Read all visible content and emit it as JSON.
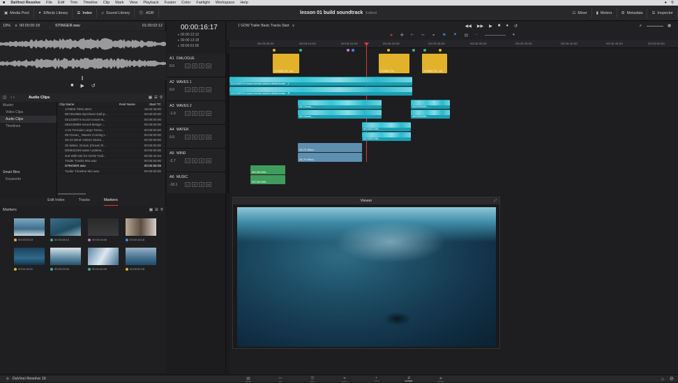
{
  "menubar": {
    "app": "DaVinci Resolve",
    "items": [
      "File",
      "Edit",
      "Trim",
      "Timeline",
      "Clip",
      "Mark",
      "View",
      "Playback",
      "Fusion",
      "Color",
      "Fairlight",
      "Workspace",
      "Help"
    ]
  },
  "toolbar": {
    "media_pool": "Media Pool",
    "effects_library": "Effects Library",
    "index": "Index",
    "sound_library": "Sound Library",
    "adr": "ADR",
    "project_title": "lesson 01 build soundtrack",
    "project_status": "Edited",
    "mixer": "Mixer",
    "meters": "Meters",
    "metadata": "Metadata",
    "inspector": "Inspector"
  },
  "source": {
    "zoom": "19%",
    "timecode_left": "00:00:00:18",
    "clip_name": "STINGER.wav",
    "timecode_right": "01:00:02:12"
  },
  "timeline_header": {
    "timecode": "00:00:16:17",
    "timeline_name": "1 GOW Trailer Basic Tracks Start",
    "tc_rows": [
      "00:00:12:12",
      "00:00:13:18",
      "00:00:01:06"
    ],
    "ruler": [
      "00:00:05:00",
      "00:00:10:00",
      "00:00:15:00",
      "00:00:20:00",
      "00:00:25:00",
      "00:00:30:00",
      "00:00:35:00",
      "00:00:40:00",
      "00:00:45:00",
      "00:00:50:00"
    ]
  },
  "media_pool": {
    "title": "Audio Clips",
    "bins": [
      "Master",
      "Video Clips",
      "Audio Clips",
      "Timelines"
    ],
    "smart_bins": "Smart Bins",
    "keywords": "Keywords",
    "columns": [
      "Clip Name",
      "Reel Name",
      "Start TC"
    ],
    "clips": [
      {
        "name": "170902-T001.WAV",
        "tc": "18:02:49:00"
      },
      {
        "name": "957461985-styrofoam-ball-p...",
        "tc": "00:00:00:00"
      },
      {
        "name": "021230974-muzzi-crown-w...",
        "tc": "00:00:00:00"
      },
      {
        "name": "062240650-sound-design-...",
        "tc": "00:00:00:00"
      },
      {
        "name": "1-04 Tornado Large Torna...",
        "tc": "00:00:00:00"
      },
      {
        "name": "08 Ocean_ Waves Coming I...",
        "tc": "00:00:00:00"
      },
      {
        "name": "25-10 Wind Violent Storm...",
        "tc": "00:00:00:00"
      },
      {
        "name": "25 Water, Ocean (Ocean R...",
        "tc": "00:00:00:00"
      },
      {
        "name": "000932156-water-underw...",
        "tc": "00:00:00:00"
      },
      {
        "name": "Get With Me for GOW Trail...",
        "tc": "00:00:24:04"
      },
      {
        "name": "Trailer Tracks Mix.wav",
        "tc": "00:00:00:00"
      },
      {
        "name": "STINGER.wav",
        "tc": "00:00:58:09"
      },
      {
        "name": "Trailer Timeline Mix.wav",
        "tc": "00:00:00:00"
      }
    ]
  },
  "index_tabs": [
    "Edit Index",
    "Tracks",
    "Markers"
  ],
  "markers": {
    "title": "Markers",
    "items": [
      {
        "tc": "00:00:03:19",
        "color": "#e2b22a"
      },
      {
        "tc": "00:00:08:13",
        "color": "#3fb27f"
      },
      {
        "tc": "00:00:16:06",
        "color": "#c77ad6"
      },
      {
        "tc": "00:00:15:18",
        "color": "#3a8ee6"
      },
      {
        "tc": "00:00:18:01",
        "color": "#e2b22a"
      },
      {
        "tc": "00:00:23:04",
        "color": "#3fb27f"
      },
      {
        "tc": "00:00:30:05",
        "color": "#3fb27f"
      },
      {
        "tc": "00:00:52:18",
        "color": "#e2b22a"
      }
    ]
  },
  "tracks": [
    {
      "id": "A1",
      "name": "DIALOGUE",
      "vol": "0.0"
    },
    {
      "id": "A2",
      "name": "WAVES 1",
      "vol": "0.0"
    },
    {
      "id": "A3",
      "name": "WAVES 2",
      "vol": "-1.0"
    },
    {
      "id": "A4",
      "name": "WATER",
      "vol": "0.0"
    },
    {
      "id": "A5",
      "name": "WIND",
      "vol": "-2.7"
    },
    {
      "id": "A6",
      "name": "MUSIC",
      "vol": "-10.1"
    }
  ],
  "clips": {
    "yellow1": "170902-T0...A1",
    "yellow2": "170902-T0...",
    "yellow3": "170902-T0...A1",
    "waves1a": "021230974-muzzi-ocean-waves-distant.wav - L",
    "waves1b": "021230974-muzzi-ocean-waves-distant.wav - R",
    "ocean1": "08 Ocean_...",
    "ocean2": "08 Ocean_...",
    "ocean3": "062240650...",
    "ocean4": "062240650...",
    "water1": "00.0002156...",
    "water2": "00.0002156...",
    "wind1": "25-70 Wind...",
    "wind2": "25-70 Wind...",
    "music1": "957461985...",
    "music2": "957461985..."
  },
  "viewer": {
    "title": "Viewer"
  },
  "footer": {
    "app_name": "DaVinci Resolve 16",
    "pages": [
      "Media",
      "Cut",
      "Edit",
      "Fusion",
      "Color",
      "Fairlight",
      "Deliver"
    ],
    "active_page": "Fairlight"
  },
  "colors": {
    "accent_red": "#e03a3a",
    "teal_clip": "#1a9fb3",
    "yellow_clip": "#e2b22a",
    "green_clip": "#3f9c5c"
  }
}
